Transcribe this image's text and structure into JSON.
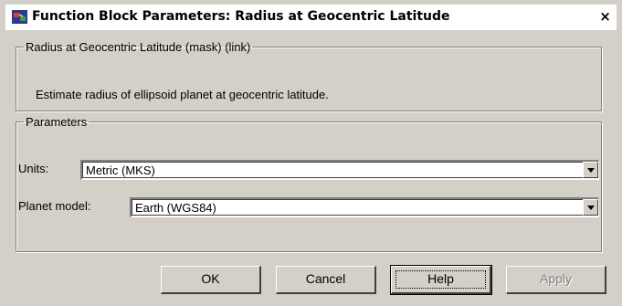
{
  "window": {
    "title": "Function Block Parameters: Radius at Geocentric Latitude",
    "close_glyph": "×",
    "icon": "simulink-block-icon"
  },
  "block_group": {
    "legend": "Radius at Geocentric Latitude (mask) (link)",
    "description": "Estimate radius of ellipsoid planet at geocentric latitude."
  },
  "params_group": {
    "legend": "Parameters",
    "units_label": "Units:",
    "units_value": "Metric (MKS)",
    "planet_label": "Planet model:",
    "planet_value": "Earth (WGS84)"
  },
  "buttons": {
    "ok": "OK",
    "cancel": "Cancel",
    "help": "Help",
    "apply": "Apply"
  },
  "colors": {
    "face": "#d4d0c8",
    "disabled_text": "#808080"
  }
}
